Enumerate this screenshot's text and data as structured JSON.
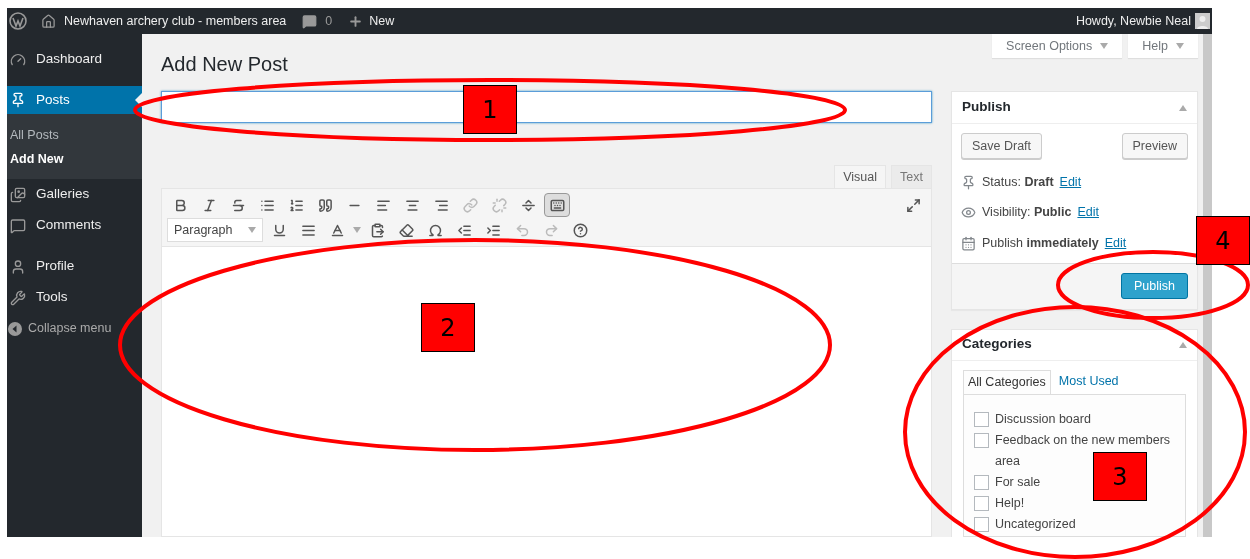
{
  "admin_bar": {
    "site_name": "Newhaven archery club - members area",
    "comments_count": "0",
    "new_label": "New",
    "greeting": "Howdy, Newbie Neal"
  },
  "sidebar": {
    "items": [
      {
        "label": "Dashboard",
        "selected": false
      },
      {
        "label": "Posts",
        "selected": true,
        "children": [
          {
            "label": "All Posts",
            "selected": false
          },
          {
            "label": "Add New",
            "selected": true
          }
        ]
      },
      {
        "label": "Galleries",
        "selected": false
      },
      {
        "label": "Comments",
        "selected": false
      },
      {
        "label": "Profile",
        "selected": false
      },
      {
        "label": "Tools",
        "selected": false
      }
    ],
    "collapse": "Collapse menu"
  },
  "screen_tabs": [
    "Screen Options",
    "Help"
  ],
  "page_title": "Add New Post",
  "title_field": {
    "focused": true
  },
  "editor": {
    "tabs": [
      {
        "label": "Visual",
        "selected": true
      },
      {
        "label": "Text",
        "selected": false
      }
    ],
    "format_select": "Paragraph",
    "kitchen_sink_on": true,
    "link_disabled": true,
    "undo_disabled": true,
    "redo_disabled": true
  },
  "publish_box": {
    "title": "Publish",
    "save_draft": "Save Draft",
    "preview": "Preview",
    "rows": [
      {
        "label": "Status:",
        "value": "Draft",
        "link": "Edit"
      },
      {
        "label": "Visibility:",
        "value": "Public",
        "link": "Edit"
      },
      {
        "label": "Publish",
        "value": "immediately",
        "link": "Edit"
      }
    ],
    "publish_button": "Publish"
  },
  "categories_box": {
    "title": "Categories",
    "tabs": [
      {
        "label": "All Categories",
        "selected": true
      },
      {
        "label": "Most Used",
        "selected": false
      }
    ],
    "items": [
      {
        "label": "Discussion board",
        "checked": false
      },
      {
        "label": "Feedback on the new members area",
        "checked": false
      },
      {
        "label": "For sale",
        "checked": false
      },
      {
        "label": "Help!",
        "checked": false
      },
      {
        "label": "Uncategorized",
        "checked": false
      }
    ]
  },
  "annotations": [
    {
      "number": "1"
    },
    {
      "number": "2"
    },
    {
      "number": "3"
    },
    {
      "number": "4"
    }
  ]
}
